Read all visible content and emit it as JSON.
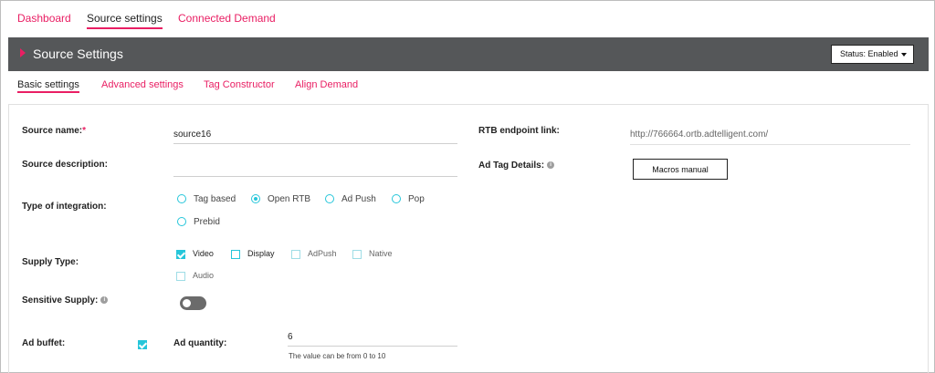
{
  "top_tabs": [
    "Dashboard",
    "Source settings",
    "Connected Demand"
  ],
  "header": {
    "title": "Source Settings",
    "status_label": "Status: Enabled"
  },
  "sub_tabs": [
    "Basic settings",
    "Advanced settings",
    "Tag Constructor",
    "Align Demand"
  ],
  "form": {
    "source_name": {
      "label": "Source name:",
      "required_mark": "*",
      "value": "source16"
    },
    "source_description": {
      "label": "Source description:",
      "value": ""
    },
    "integration": {
      "label": "Type of integration:",
      "options": [
        "Tag based",
        "Open RTB",
        "Ad Push",
        "Pop",
        "Prebid"
      ],
      "selected": "Open RTB"
    },
    "supply_type": {
      "label": "Supply Type:",
      "options": [
        "Video",
        "Display",
        "AdPush",
        "Native",
        "Audio"
      ],
      "checked": [
        "Video"
      ]
    },
    "sensitive_supply": {
      "label": "Sensitive Supply:",
      "enabled": false
    },
    "ad_buffet": {
      "label": "Ad buffet:",
      "checked": true
    },
    "ad_quantity": {
      "label": "Ad quantity:",
      "value": "6",
      "hint": "The value can be from 0 to 10"
    },
    "rtb_endpoint": {
      "label": "RTB endpoint link:",
      "value": "http://766664.ortb.adtelligent.com/"
    },
    "ad_tag_details": {
      "label": "Ad Tag Details:",
      "button": "Macros manual"
    }
  },
  "colors": {
    "accent": "#e91e63",
    "checkbox": "#26c6da",
    "header_bg": "#555759"
  }
}
